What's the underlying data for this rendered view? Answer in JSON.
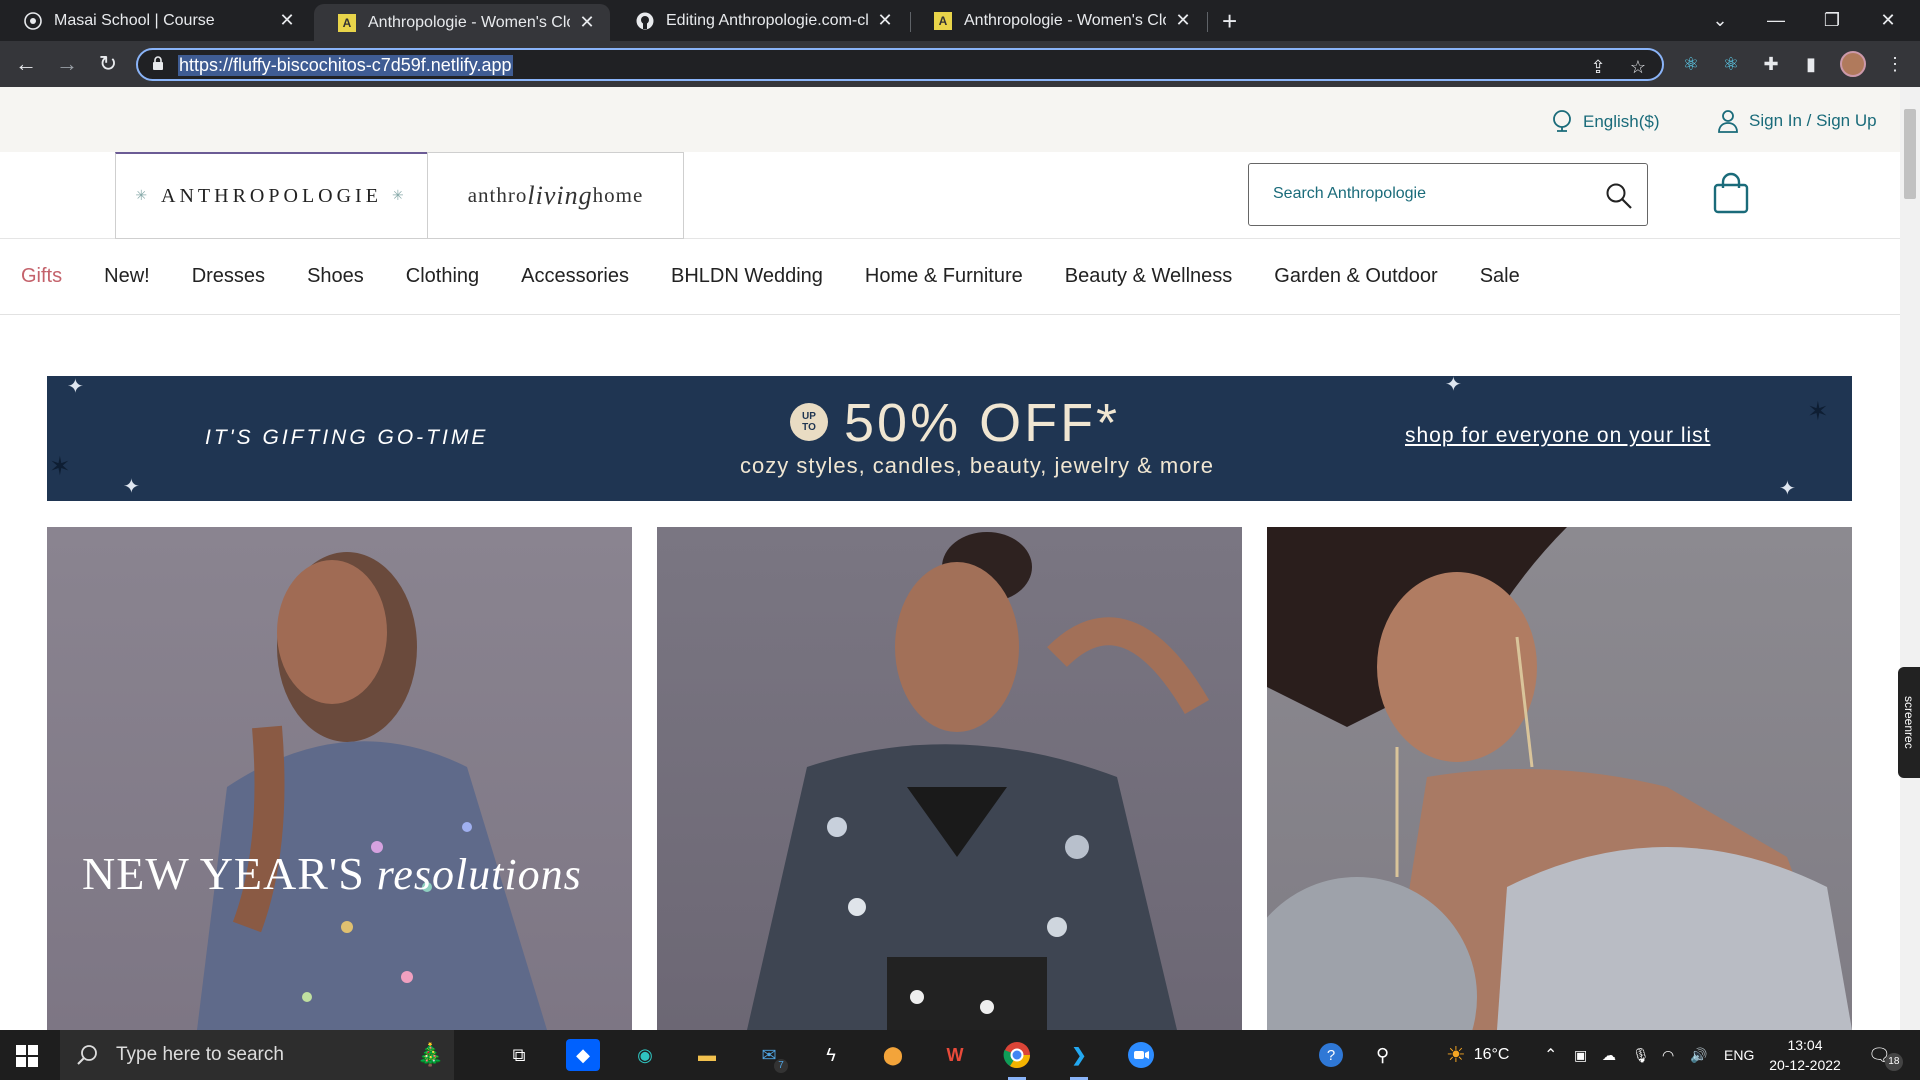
{
  "browser": {
    "tabs": [
      {
        "title": "Masai School | Course",
        "favicon": "masai-icon",
        "active": false
      },
      {
        "title": "Anthropologie - Women's Clothir",
        "favicon": "anthropologie-icon",
        "active": true
      },
      {
        "title": "Editing Anthropologie.com-clone",
        "favicon": "github-icon",
        "active": false
      },
      {
        "title": "Anthropologie - Women's Clothir",
        "favicon": "anthropologie-icon",
        "active": false
      }
    ],
    "url": "https://fluffy-biscochitos-c7d59f.netlify.app"
  },
  "utility": {
    "language": "English($)",
    "signin": "Sign In / Sign Up"
  },
  "header": {
    "brand_main": "ANTHROPOLOGIE",
    "brand_living_left": "anthro",
    "brand_living_mid": "living",
    "brand_living_right": "home",
    "search_placeholder": "Search Anthropologie"
  },
  "nav": {
    "items": [
      "Gifts",
      "New!",
      "Dresses",
      "Shoes",
      "Clothing",
      "Accessories",
      "BHLDN Wedding",
      "Home & Furniture",
      "Beauty & Wellness",
      "Garden & Outdoor",
      "Sale"
    ]
  },
  "promo": {
    "left": "IT'S GIFTING GO-TIME",
    "badge_top": "UP",
    "badge_bottom": "TO",
    "headline": "50% OFF*",
    "sub": "cozy styles, candles, beauty, jewelry & more",
    "right": "shop for everyone on your list"
  },
  "hero": {
    "caption_main": "NEW YEAR'S",
    "caption_script": "resolutions"
  },
  "screenrec": "screenrec",
  "taskbar": {
    "search_placeholder": "Type here to search",
    "mail_badge": "7",
    "weather": "16°C",
    "language": "ENG",
    "time": "13:04",
    "date": "20-12-2022",
    "notifications": "18"
  },
  "colors": {
    "accent_teal": "#1a6b7a",
    "gifts_pink": "#c4626b",
    "promo_navy": "#1f3552"
  }
}
